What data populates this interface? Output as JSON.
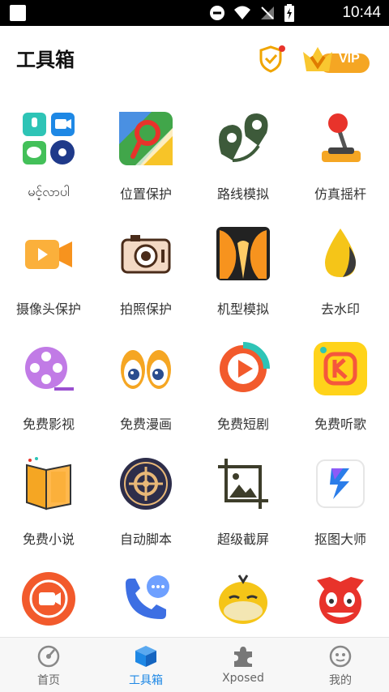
{
  "status_bar": {
    "time": "10:44"
  },
  "header": {
    "title": "工具箱",
    "vip_label": "VIP"
  },
  "tools": [
    {
      "label": "မင့်လာပါ",
      "icon": "app-launcher-icon"
    },
    {
      "label": "位置保护",
      "icon": "map-pin-icon"
    },
    {
      "label": "路线模拟",
      "icon": "route-pins-icon"
    },
    {
      "label": "仿真摇杆",
      "icon": "joystick-icon"
    },
    {
      "label": "摄像头保护",
      "icon": "video-camera-icon"
    },
    {
      "label": "拍照保护",
      "icon": "photo-camera-icon"
    },
    {
      "label": "机型模拟",
      "icon": "phone-model-icon"
    },
    {
      "label": "去水印",
      "icon": "water-drop-icon"
    },
    {
      "label": "免费影视",
      "icon": "film-reel-icon"
    },
    {
      "label": "免费漫画",
      "icon": "cartoon-eyes-icon"
    },
    {
      "label": "免费短剧",
      "icon": "play-circle-icon"
    },
    {
      "label": "免费听歌",
      "icon": "music-k-icon"
    },
    {
      "label": "免费小说",
      "icon": "book-icon"
    },
    {
      "label": "自动脚本",
      "icon": "crosshair-icon"
    },
    {
      "label": "超级截屏",
      "icon": "crop-screenshot-icon"
    },
    {
      "label": "抠图大师",
      "icon": "cutout-icon"
    },
    {
      "label": "",
      "icon": "screen-record-icon"
    },
    {
      "label": "",
      "icon": "phone-call-icon"
    },
    {
      "label": "",
      "icon": "duck-icon"
    },
    {
      "label": "",
      "icon": "clown-icon"
    }
  ],
  "nav": [
    {
      "label": "首页",
      "icon": "home-disc-icon",
      "active": false
    },
    {
      "label": "工具箱",
      "icon": "cube-icon",
      "active": true
    },
    {
      "label": "Xposed",
      "icon": "puzzle-icon",
      "active": false
    },
    {
      "label": "我的",
      "icon": "profile-face-icon",
      "active": false
    }
  ],
  "colors": {
    "accent": "#1e88e5",
    "vip_gold": "#f5a623"
  }
}
